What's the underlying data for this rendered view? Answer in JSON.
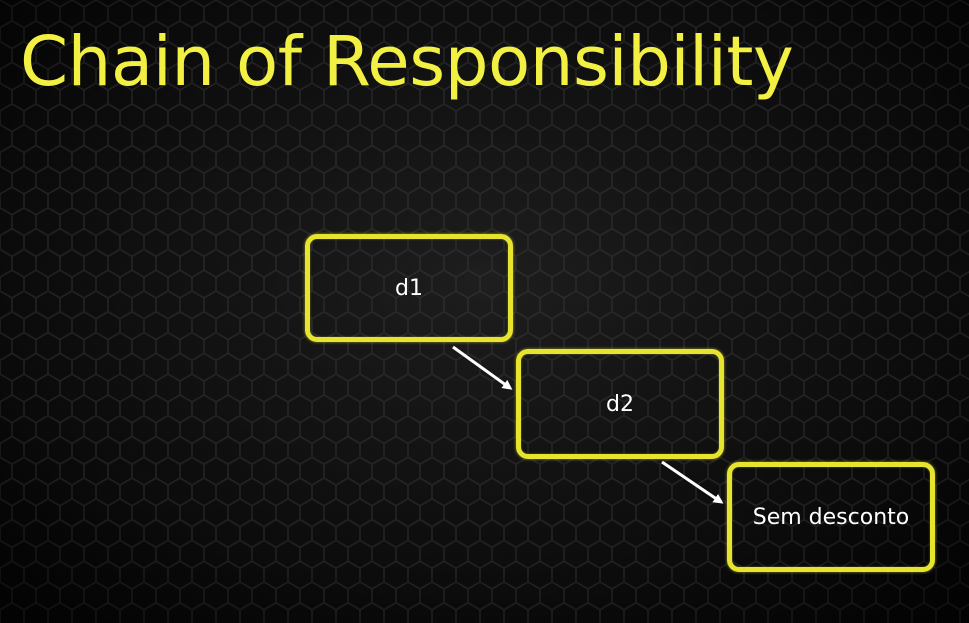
{
  "slide": {
    "title": "Chain of Responsibility",
    "accent_color": "#f2f042",
    "background_color": "#111111"
  },
  "diagram": {
    "nodes": [
      {
        "id": "d1",
        "label": "d1"
      },
      {
        "id": "d2",
        "label": "d2"
      },
      {
        "id": "sem-desconto",
        "label": "Sem desconto"
      }
    ],
    "edges": [
      {
        "from": "d1",
        "to": "d2"
      },
      {
        "from": "d2",
        "to": "sem-desconto"
      }
    ]
  }
}
